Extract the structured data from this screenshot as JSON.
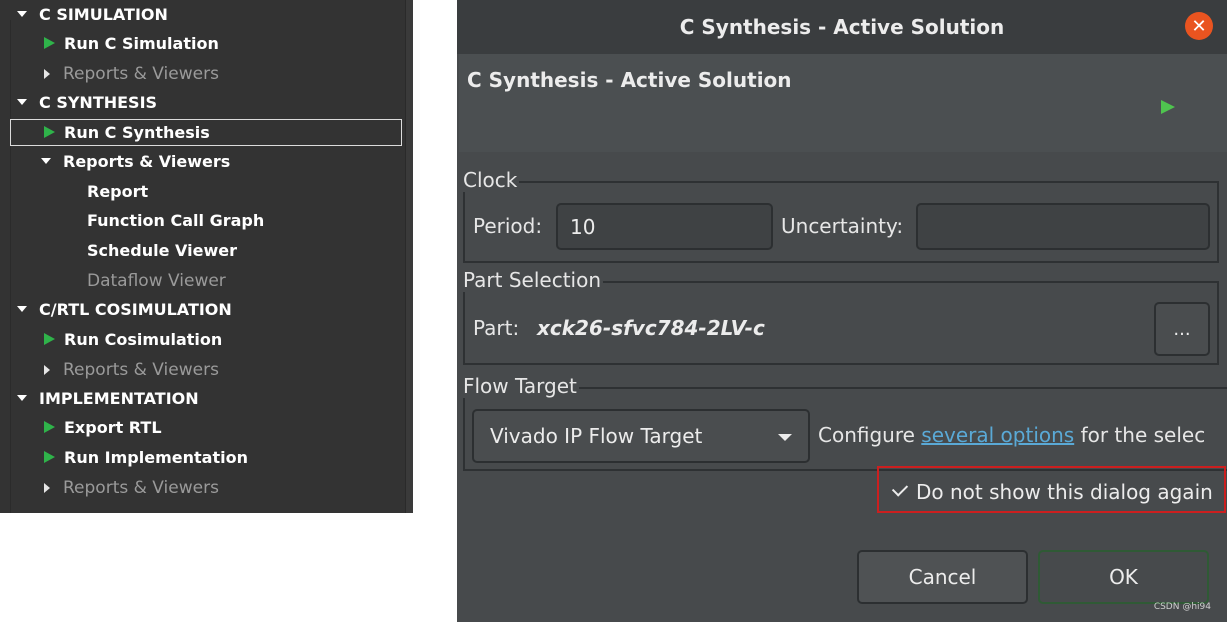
{
  "navigator": {
    "sections": [
      {
        "title": "C SIMULATION",
        "items": [
          {
            "label": "Run C Simulation",
            "kind": "run"
          },
          {
            "label": "Reports & Viewers",
            "kind": "collapsed",
            "disabled": true
          }
        ]
      },
      {
        "title": "C SYNTHESIS",
        "items": [
          {
            "label": "Run C Synthesis",
            "kind": "run",
            "selected": true
          },
          {
            "label": "Reports & Viewers",
            "kind": "expanded"
          },
          {
            "label": "Report",
            "kind": "child"
          },
          {
            "label": "Function Call Graph",
            "kind": "child"
          },
          {
            "label": "Schedule Viewer",
            "kind": "child"
          },
          {
            "label": "Dataflow Viewer",
            "kind": "child",
            "disabled": true
          }
        ]
      },
      {
        "title": "C/RTL COSIMULATION",
        "items": [
          {
            "label": "Run Cosimulation",
            "kind": "run"
          },
          {
            "label": "Reports & Viewers",
            "kind": "collapsed",
            "disabled": true
          }
        ]
      },
      {
        "title": "IMPLEMENTATION",
        "items": [
          {
            "label": "Export RTL",
            "kind": "run"
          },
          {
            "label": "Run Implementation",
            "kind": "run"
          },
          {
            "label": "Reports & Viewers",
            "kind": "collapsed",
            "disabled": true
          }
        ]
      }
    ]
  },
  "dialog": {
    "window_title": "C Synthesis - Active Solution",
    "close_icon": "close-icon",
    "header_title": "C Synthesis - Active Solution",
    "clock": {
      "group_label": "Clock",
      "period_label": "Period:",
      "period_value": "10",
      "uncertainty_label": "Uncertainty:",
      "uncertainty_value": ""
    },
    "part_selection": {
      "group_label": "Part Selection",
      "part_label": "Part:",
      "part_value": "xck26-sfvc784-2LV-c",
      "browse_label": "..."
    },
    "flow_target": {
      "group_label": "Flow Target",
      "selected": "Vivado IP Flow Target",
      "text_before": "Configure ",
      "link_text": "several options",
      "text_after": " for the selec"
    },
    "dont_show_label": "Do not show this dialog again",
    "dont_show_checked": true,
    "cancel_label": "Cancel",
    "ok_label": "OK"
  },
  "watermark": "CSDN @hi94",
  "colors": {
    "run_icon": "#2fb34a",
    "highlight_border": "#cc1f1f",
    "link": "#5aa9d6",
    "close_button": "#e95420"
  }
}
